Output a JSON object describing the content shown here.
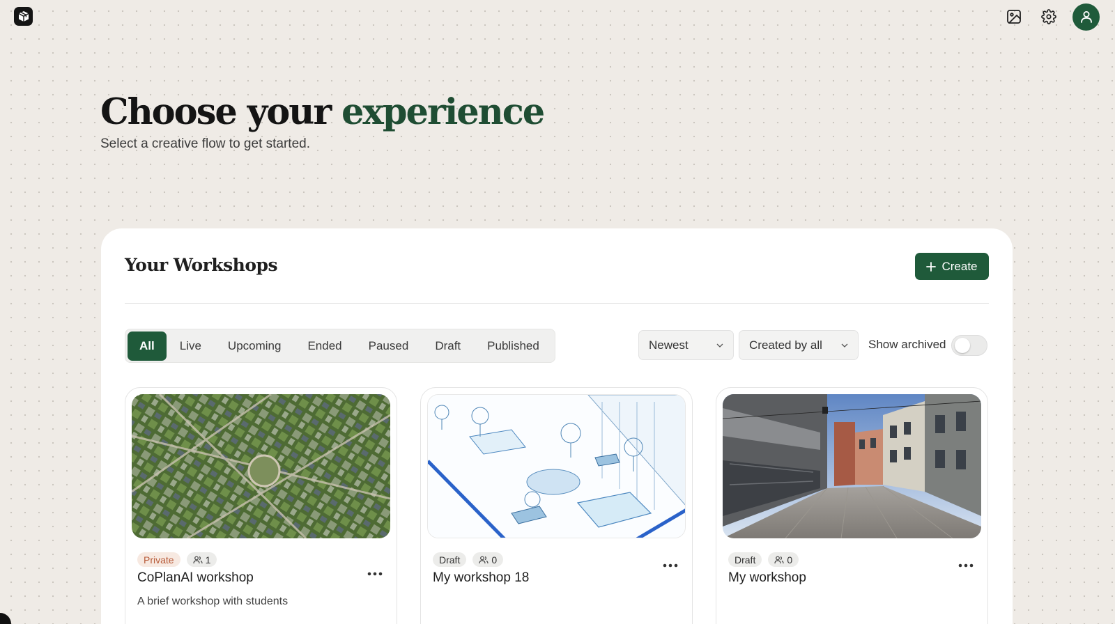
{
  "header": {
    "logo_icon": "cube-icon",
    "icons": [
      "image-gallery-icon",
      "gear-icon",
      "user-icon"
    ],
    "accent_color": "#1f5a3a"
  },
  "hero": {
    "title_plain": "Choose your",
    "title_accent": "experience",
    "subtitle": "Select a creative flow to get started."
  },
  "workshops": {
    "title": "Your Workshops",
    "create_label": "Create",
    "tabs": [
      {
        "label": "All",
        "active": true
      },
      {
        "label": "Live"
      },
      {
        "label": "Upcoming"
      },
      {
        "label": "Ended"
      },
      {
        "label": "Paused"
      },
      {
        "label": "Draft"
      },
      {
        "label": "Published"
      }
    ],
    "sort_value": "Newest",
    "creator_filter_value": "Created by all",
    "show_archived_label": "Show archived",
    "show_archived": false,
    "cards": [
      {
        "status": "Private",
        "participants": "1",
        "title": "CoPlanAI workshop",
        "description": "A brief workshop with students",
        "image": "aerial-city-photo"
      },
      {
        "status": "Draft",
        "participants": "0",
        "title": "My workshop 18",
        "description": "",
        "image": "isometric-plaza-drawing"
      },
      {
        "status": "Draft",
        "participants": "0",
        "title": "My workshop",
        "description": "",
        "image": "street-photo"
      }
    ]
  }
}
